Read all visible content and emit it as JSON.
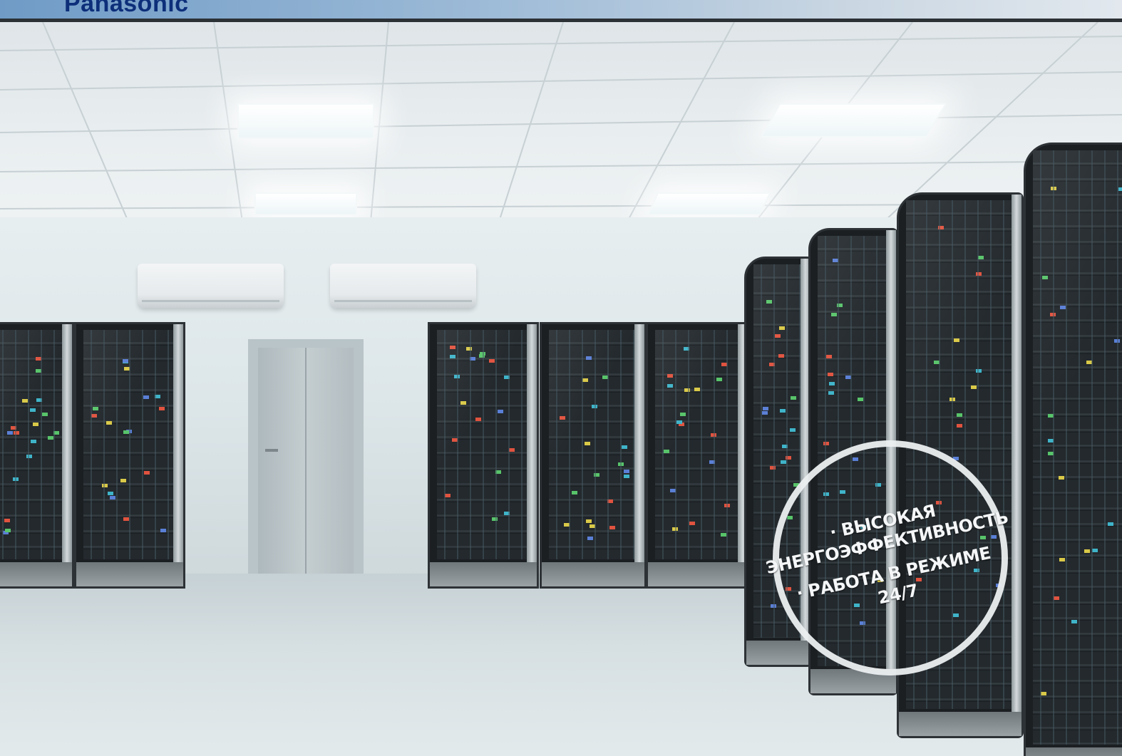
{
  "brand": {
    "name": "Panasonic"
  },
  "badge": {
    "line1": "· ВЫСОКАЯ",
    "line2": "ЭНЕРГОЭФФЕКТИВНОСТЬ",
    "line3": "· РАБОТА В РЕЖИМЕ",
    "line4": "24/7"
  },
  "colors": {
    "brand": "#0d2f7a",
    "badge_ring": "#eceff0"
  }
}
